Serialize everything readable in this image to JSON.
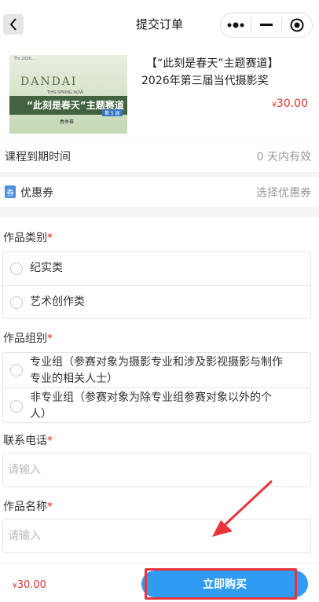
{
  "header": {
    "title": "提交订单",
    "back_icon": "chevron-left-icon",
    "capsule": [
      "more-dots-icon",
      "minimize-icon",
      "target-close-icon"
    ]
  },
  "product": {
    "poster": {
      "top_text": "Thi 2026...",
      "brand": "DANDAI",
      "sub": "THIS SPRING NOW",
      "theme": "“此刻是春天”主题赛道",
      "badge": "第 5 届",
      "author": "春季赛"
    },
    "title_line1": "【“此刻是春天”主题赛道】",
    "title_line2": "2026年第三届当代摄影奖",
    "price_symbol": "¥",
    "price": "30.00"
  },
  "validity": {
    "label": "课程到期时间",
    "value": "0 天内有效"
  },
  "coupon": {
    "icon_char": "券",
    "label": "优惠券",
    "value": "选择优惠券"
  },
  "form": {
    "category": {
      "label": "作品类别",
      "required_mark": "*",
      "options": [
        "纪实类",
        "艺术创作类"
      ]
    },
    "group": {
      "label": "作品组别",
      "required_mark": "*",
      "options": [
        {
          "line1": "专业组（参赛对象为摄影专业和涉及影视摄影与制作",
          "line2": "专业的相关人士）"
        },
        {
          "line1": " 非专业组（参赛对象为除专业组参赛对象以外的个",
          "line2": "人）"
        }
      ]
    },
    "phone": {
      "label": "联系电话",
      "required_mark": "*",
      "placeholder": "请输入"
    },
    "title": {
      "label": "作品名称",
      "required_mark": "*",
      "placeholder": "请输入"
    }
  },
  "footer": {
    "price_symbol": "¥",
    "price": "30.00",
    "buy_label": "立即购买"
  },
  "colors": {
    "accent": "#2f9bf3",
    "price": "#d9342b",
    "annotation": "#e8343b",
    "required": "#e02020"
  }
}
